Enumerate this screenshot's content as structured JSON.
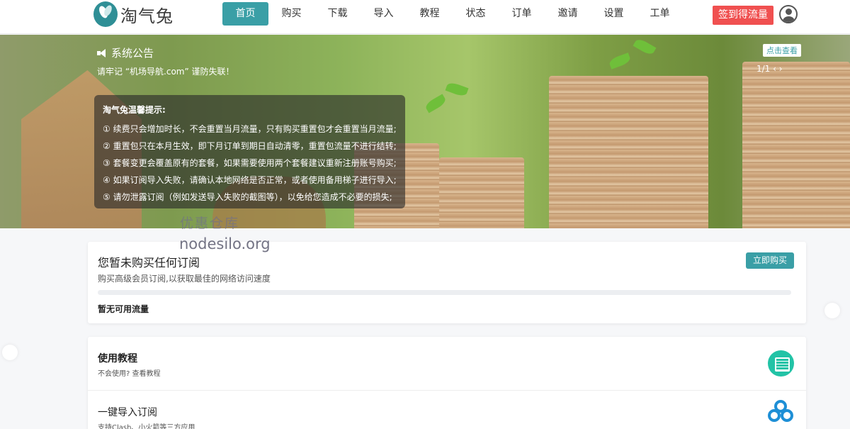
{
  "brand": {
    "name": "淘气兔",
    "logo_icon": "rabbit-logo-icon"
  },
  "nav": {
    "items": [
      {
        "label": "首页",
        "active": true
      },
      {
        "label": "购买"
      },
      {
        "label": "下载"
      },
      {
        "label": "导入"
      },
      {
        "label": "教程"
      },
      {
        "label": "状态"
      },
      {
        "label": "订单"
      },
      {
        "label": "邀请"
      },
      {
        "label": "设置"
      },
      {
        "label": "工单"
      }
    ],
    "signin_label": "签到得流量",
    "avatar_icon": "user-avatar-icon"
  },
  "banner": {
    "notice_title": "系统公告",
    "notice_text": "请牢记 “机场导航.com” 谨防失联！",
    "view_label": "点击查看",
    "pager": "1/1 ‹ ›",
    "tips": {
      "title": "淘气兔温馨提示:",
      "lines": [
        "① 续费只会增加时长，不会重置当月流量，只有购买重置包才会重置当月流量;",
        "② 重置包只在本月生效，即下月订单到期日自动清零，重置包流量不进行结转;",
        "③ 套餐变更会覆盖原有的套餐，如果需要使用两个套餐建议重新注册账号购买;",
        "④ 如果订阅导入失败，请确认本地网络是否正常，或者使用备用梯子进行导入;",
        "⑤ 请勿泄露订阅（例如发送导入失败的截图等），以免给您造成不必要的损失;"
      ]
    }
  },
  "watermark": {
    "line1": "优惠仓库",
    "line2": "nodesilo.org"
  },
  "subscription": {
    "title": "您暂未购买任何订阅",
    "desc": "购买高级会员订阅,以获取最佳的网络访问速度",
    "buy_label": "立即购买",
    "traffic_label": "暂无可用流量",
    "progress": 0
  },
  "shortcuts": [
    {
      "title": "使用教程",
      "sub": "不会使用? 查看教程",
      "icon": "book-icon"
    },
    {
      "title": "一键导入订阅",
      "sub": "支持Clash、小火箭等三方应用",
      "icon": "link-icon"
    }
  ],
  "colors": {
    "accent": "#3a9fa6",
    "danger": "#f05050"
  }
}
